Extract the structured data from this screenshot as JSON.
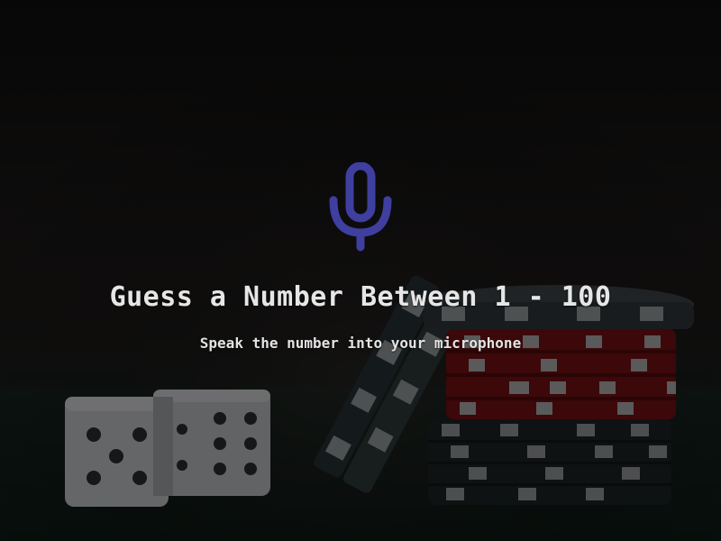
{
  "page": {
    "title": "Guess a Number Between 1 - 100",
    "subtitle": "Speak the number into your microphone"
  },
  "icons": {
    "microphone": "microphone-icon"
  },
  "colors": {
    "accent": "#3f3fa0",
    "text": "#e6e6e6",
    "background": "#141212",
    "felt": "#0f1c17",
    "chip_red": "#7a1214",
    "chip_dark": "#1e2326",
    "chip_stripe": "#9a9a9a",
    "die_face": "#b8b8bc"
  }
}
